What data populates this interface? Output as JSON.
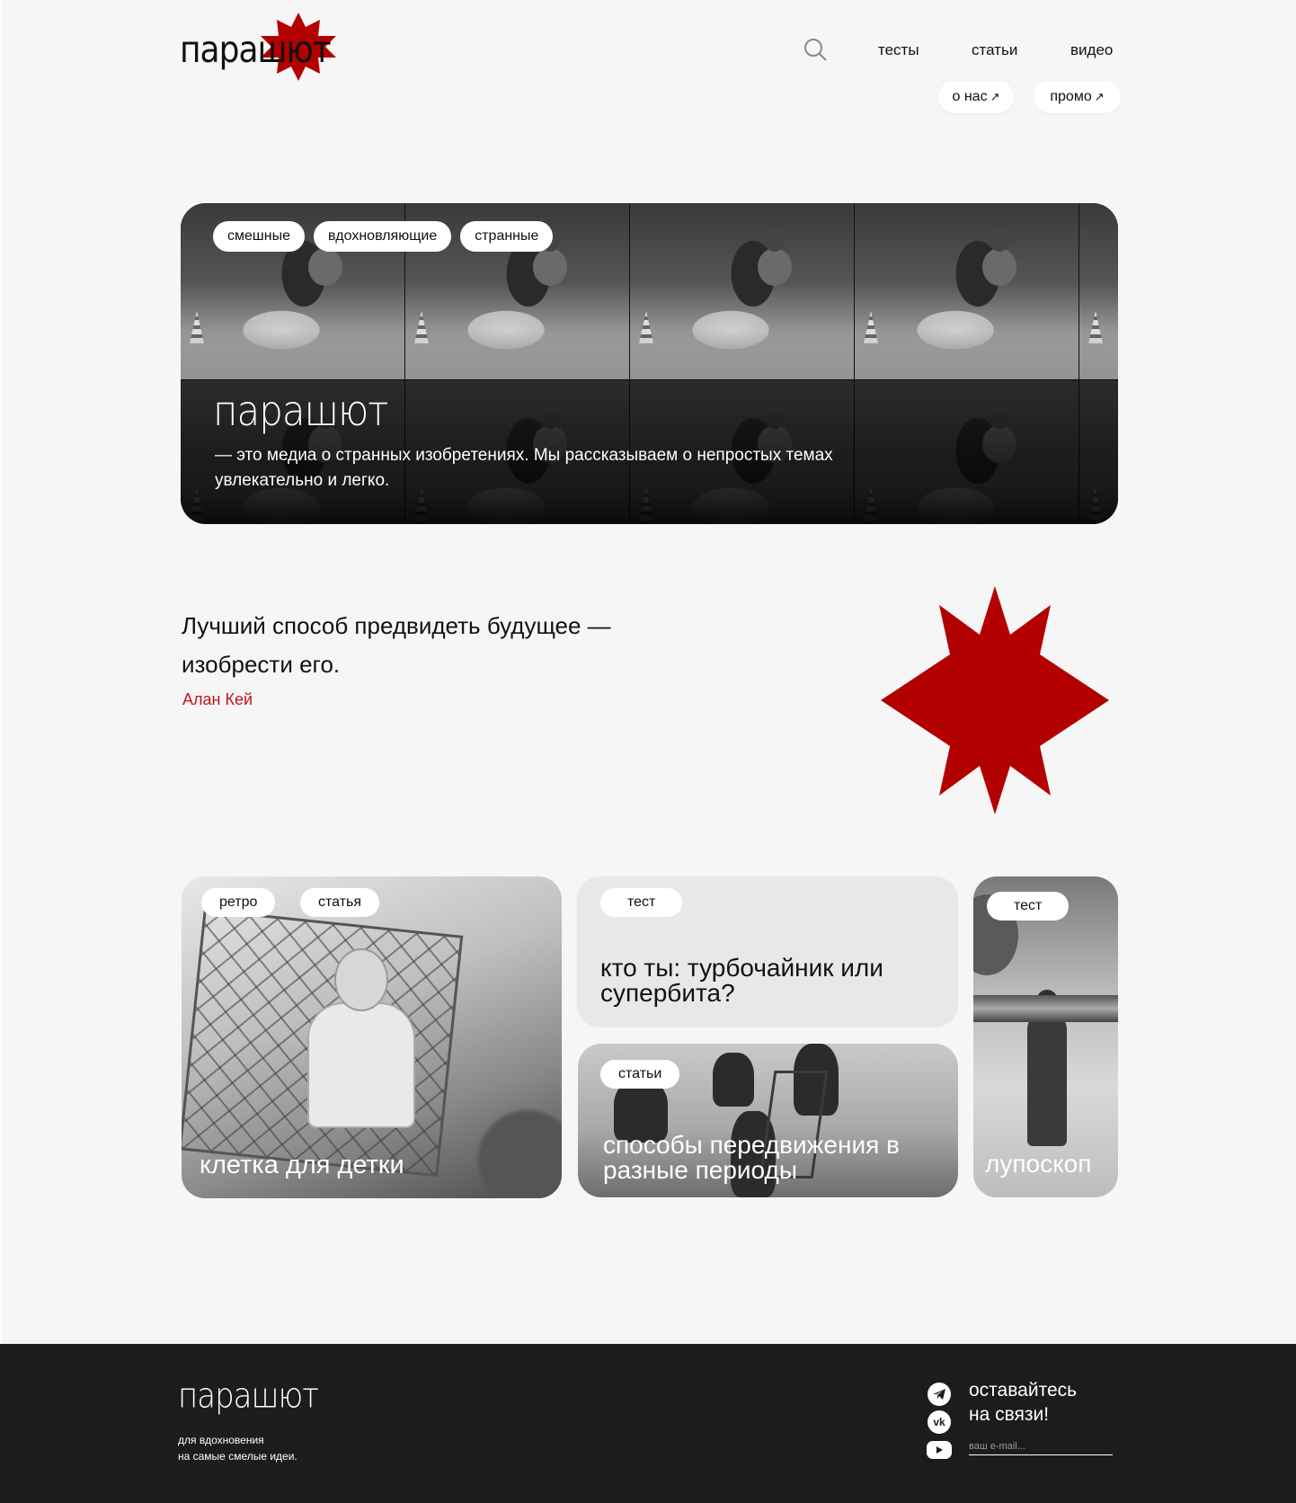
{
  "brand": {
    "logo_text": "парашют",
    "accent_color": "#b30000"
  },
  "header": {
    "search_icon": "search-icon",
    "nav": [
      "тесты",
      "статьи",
      "видео"
    ],
    "external_links": [
      {
        "label": "о нас",
        "icon": "arrow-up-right-icon"
      },
      {
        "label": "промо",
        "icon": "arrow-up-right-icon"
      }
    ]
  },
  "hero": {
    "tags": [
      "смешные",
      "вдохновляющие",
      "странные"
    ],
    "title": "парашют",
    "text": "— это медиа о странных изобретениях. Мы рассказываем о непростых темах увлекательно и легко."
  },
  "quote": {
    "text": "Лучший способ предвидеть будущее — изобрести его.",
    "author": "Алан Кей"
  },
  "cards": [
    {
      "tags": [
        "ретро",
        "статья"
      ],
      "title": "клетка для детки"
    },
    {
      "tags": [
        "тест"
      ],
      "title": "кто ты: турбочайник или супербита?"
    },
    {
      "tags": [
        "статьи"
      ],
      "title": "способы передвижения в разные периоды"
    },
    {
      "tags": [
        "тест"
      ],
      "title": "лупоскоп"
    }
  ],
  "footer": {
    "logo_text": "парашют",
    "tagline_1": "для вдохновения",
    "tagline_2": "на самые смелые идеи.",
    "cta_1": "оставайтесь",
    "cta_2": "на связи!",
    "email_placeholder": "ваш e-mail...",
    "socials": [
      "telegram-icon",
      "vk-icon",
      "youtube-icon"
    ]
  },
  "colors": {
    "background": "#f6f6f6",
    "footer": "#1c1c1c",
    "author": "#c0151a"
  }
}
